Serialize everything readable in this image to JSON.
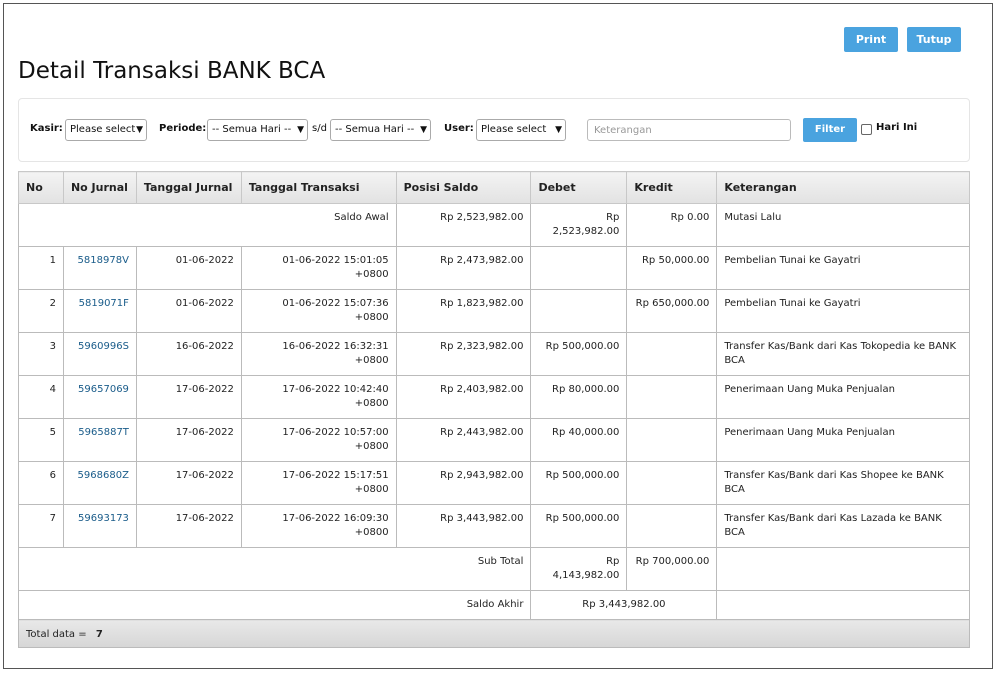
{
  "toolbar": {
    "print_label": "Print",
    "close_label": "Tutup"
  },
  "page_title": "Detail Transaksi BANK BCA",
  "filter": {
    "kasir_label": "Kasir:",
    "kasir_value": "Please select",
    "periode_label": "Periode:",
    "periode_from": "-- Semua Hari --",
    "sd_label": "s/d",
    "periode_to": "-- Semua Hari --",
    "user_label": "User:",
    "user_value": "Please select",
    "keterangan_placeholder": "Keterangan",
    "filter_button": "Filter",
    "hari_ini_label": "Hari Ini"
  },
  "table": {
    "headers": [
      "No",
      "No Jurnal",
      "Tanggal Jurnal",
      "Tanggal Transaksi",
      "Posisi Saldo",
      "Debet",
      "Kredit",
      "Keterangan"
    ],
    "saldo_awal": {
      "label": "Saldo Awal",
      "posisi": "Rp 2,523,982.00",
      "debet": "Rp 2,523,982.00",
      "kredit": "Rp 0.00",
      "keterangan": "Mutasi Lalu"
    },
    "rows": [
      {
        "no": "1",
        "jurnal": "5818978V",
        "tgl_jurnal": "01-06-2022",
        "tgl_transaksi": "01-06-2022 15:01:05 +0800",
        "posisi": "Rp 2,473,982.00",
        "debet": "",
        "kredit": "Rp 50,000.00",
        "keterangan": "Pembelian Tunai ke Gayatri"
      },
      {
        "no": "2",
        "jurnal": "5819071F",
        "tgl_jurnal": "01-06-2022",
        "tgl_transaksi": "01-06-2022 15:07:36 +0800",
        "posisi": "Rp 1,823,982.00",
        "debet": "",
        "kredit": "Rp 650,000.00",
        "keterangan": "Pembelian Tunai ke Gayatri"
      },
      {
        "no": "3",
        "jurnal": "5960996S",
        "tgl_jurnal": "16-06-2022",
        "tgl_transaksi": "16-06-2022 16:32:31 +0800",
        "posisi": "Rp 2,323,982.00",
        "debet": "Rp 500,000.00",
        "kredit": "",
        "keterangan": "Transfer Kas/Bank dari Kas Tokopedia ke BANK BCA"
      },
      {
        "no": "4",
        "jurnal": "59657069",
        "tgl_jurnal": "17-06-2022",
        "tgl_transaksi": "17-06-2022 10:42:40 +0800",
        "posisi": "Rp 2,403,982.00",
        "debet": "Rp 80,000.00",
        "kredit": "",
        "keterangan": "Penerimaan Uang Muka Penjualan"
      },
      {
        "no": "5",
        "jurnal": "5965887T",
        "tgl_jurnal": "17-06-2022",
        "tgl_transaksi": "17-06-2022 10:57:00 +0800",
        "posisi": "Rp 2,443,982.00",
        "debet": "Rp 40,000.00",
        "kredit": "",
        "keterangan": "Penerimaan Uang Muka Penjualan"
      },
      {
        "no": "6",
        "jurnal": "5968680Z",
        "tgl_jurnal": "17-06-2022",
        "tgl_transaksi": "17-06-2022 15:17:51 +0800",
        "posisi": "Rp 2,943,982.00",
        "debet": "Rp 500,000.00",
        "kredit": "",
        "keterangan": "Transfer Kas/Bank dari Kas Shopee ke BANK BCA"
      },
      {
        "no": "7",
        "jurnal": "59693173",
        "tgl_jurnal": "17-06-2022",
        "tgl_transaksi": "17-06-2022 16:09:30 +0800",
        "posisi": "Rp 3,443,982.00",
        "debet": "Rp 500,000.00",
        "kredit": "",
        "keterangan": "Transfer Kas/Bank dari Kas Lazada ke BANK BCA"
      }
    ],
    "sub_total": {
      "label": "Sub Total",
      "debet": "Rp 4,143,982.00",
      "kredit": "Rp 700,000.00"
    },
    "saldo_akhir": {
      "label": "Saldo Akhir",
      "value": "Rp 3,443,982.00"
    },
    "total_label": "Total data =",
    "total_count": "7"
  }
}
